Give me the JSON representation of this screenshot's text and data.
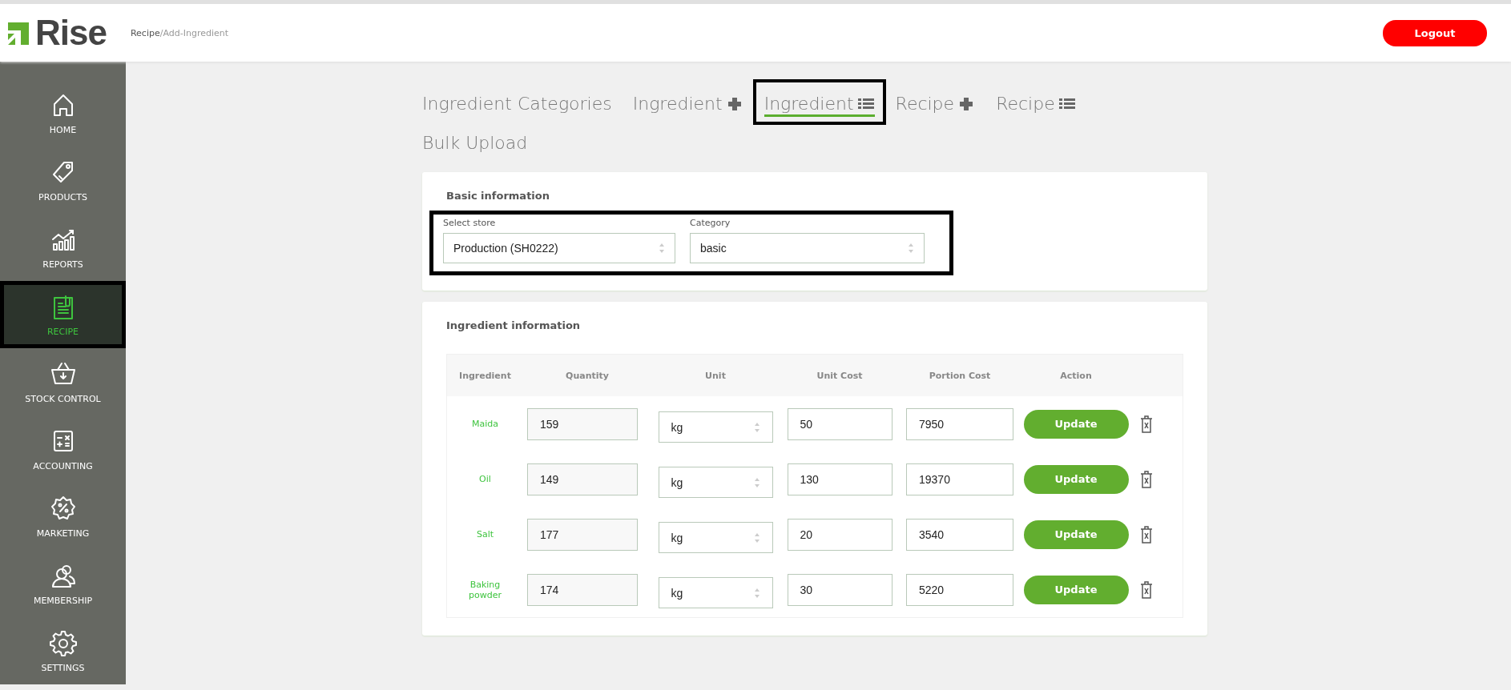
{
  "header": {
    "logo": "Rise",
    "breadcrumb": [
      {
        "label": "Recipe",
        "current": false
      },
      {
        "label": "/Add-Ingredient",
        "current": true
      }
    ],
    "logout": "Logout"
  },
  "sidebar": {
    "items": [
      {
        "label": "HOME",
        "selected": false,
        "highlighted": false
      },
      {
        "label": "PRODUCTS",
        "selected": false,
        "highlighted": false
      },
      {
        "label": "REPORTS",
        "selected": false,
        "highlighted": false
      },
      {
        "label": "RECIPE",
        "selected": true,
        "highlighted": true
      },
      {
        "label": "STOCK CONTROL",
        "selected": false,
        "highlighted": false
      },
      {
        "label": "ACCOUNTING",
        "selected": false,
        "highlighted": false
      },
      {
        "label": "MARKETING",
        "selected": false,
        "highlighted": false
      },
      {
        "label": "MEMBERSHIP",
        "selected": false,
        "highlighted": false
      },
      {
        "label": "SETTINGS",
        "selected": false,
        "highlighted": false
      }
    ]
  },
  "tabs": [
    {
      "label": "Ingredient Categories",
      "kind": "text",
      "selected": false,
      "highlighted": false
    },
    {
      "label": "Ingredient",
      "kind": "add",
      "selected": false,
      "highlighted": false
    },
    {
      "label": "Ingredient",
      "kind": "list",
      "selected": true,
      "highlighted": true
    },
    {
      "label": "Recipe",
      "kind": "add",
      "selected": false,
      "highlighted": false
    },
    {
      "label": "Recipe",
      "kind": "list",
      "selected": false,
      "highlighted": false
    },
    {
      "label": "Bulk Upload",
      "kind": "text",
      "selected": false,
      "highlighted": false
    }
  ],
  "basic_information": {
    "title": "Basic information",
    "highlighted": true,
    "fields": [
      {
        "label": "Select store",
        "value": "Production (SH0222)"
      },
      {
        "label": "Category",
        "value": "basic"
      }
    ]
  },
  "ingredient_information": {
    "title": "Ingredient information",
    "columns": [
      "Ingredient",
      "Quantity",
      "Unit",
      "Unit Cost",
      "Portion Cost",
      "Action"
    ],
    "rows": [
      {
        "ingredient": "Maida",
        "quantity": "159",
        "unit": "kg",
        "unit_cost": "50",
        "portion_cost": "7950",
        "action": "Update"
      },
      {
        "ingredient": "Oil",
        "quantity": "149",
        "unit": "kg",
        "unit_cost": "130",
        "portion_cost": "19370",
        "action": "Update"
      },
      {
        "ingredient": "Salt",
        "quantity": "177",
        "unit": "kg",
        "unit_cost": "20",
        "portion_cost": "3540",
        "action": "Update"
      },
      {
        "ingredient": "Baking powder",
        "quantity": "174",
        "unit": "kg",
        "unit_cost": "30",
        "portion_cost": "5220",
        "action": "Update"
      }
    ]
  }
}
